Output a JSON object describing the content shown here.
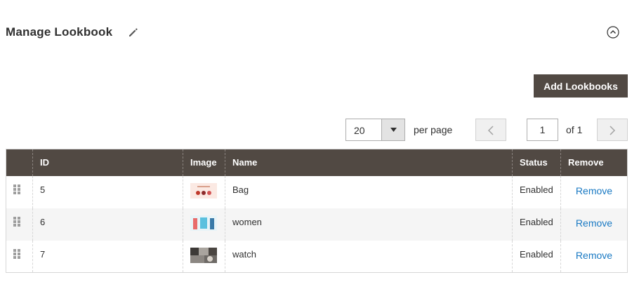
{
  "header": {
    "title": "Manage Lookbook",
    "edit_icon": "pencil-icon",
    "collapse_icon": "chevron-up-circle-icon"
  },
  "toolbar": {
    "add_label": "Add Lookbooks"
  },
  "pager": {
    "per_page_value": "20",
    "per_page_label": "per page",
    "current_page": "1",
    "of_label": "of 1"
  },
  "table": {
    "columns": [
      "ID",
      "Image",
      "Name",
      "Status",
      "Remove"
    ],
    "rows": [
      {
        "id": "5",
        "image": "bag-thumbnail",
        "name": "Bag",
        "status": "Enabled",
        "remove": "Remove"
      },
      {
        "id": "6",
        "image": "women-thumbnail",
        "name": "women",
        "status": "Enabled",
        "remove": "Remove"
      },
      {
        "id": "7",
        "image": "watch-thumbnail",
        "name": "watch",
        "status": "Enabled",
        "remove": "Remove"
      }
    ]
  },
  "colors": {
    "header_bg": "#514943",
    "button_bg": "#514943",
    "link": "#1979c3"
  }
}
